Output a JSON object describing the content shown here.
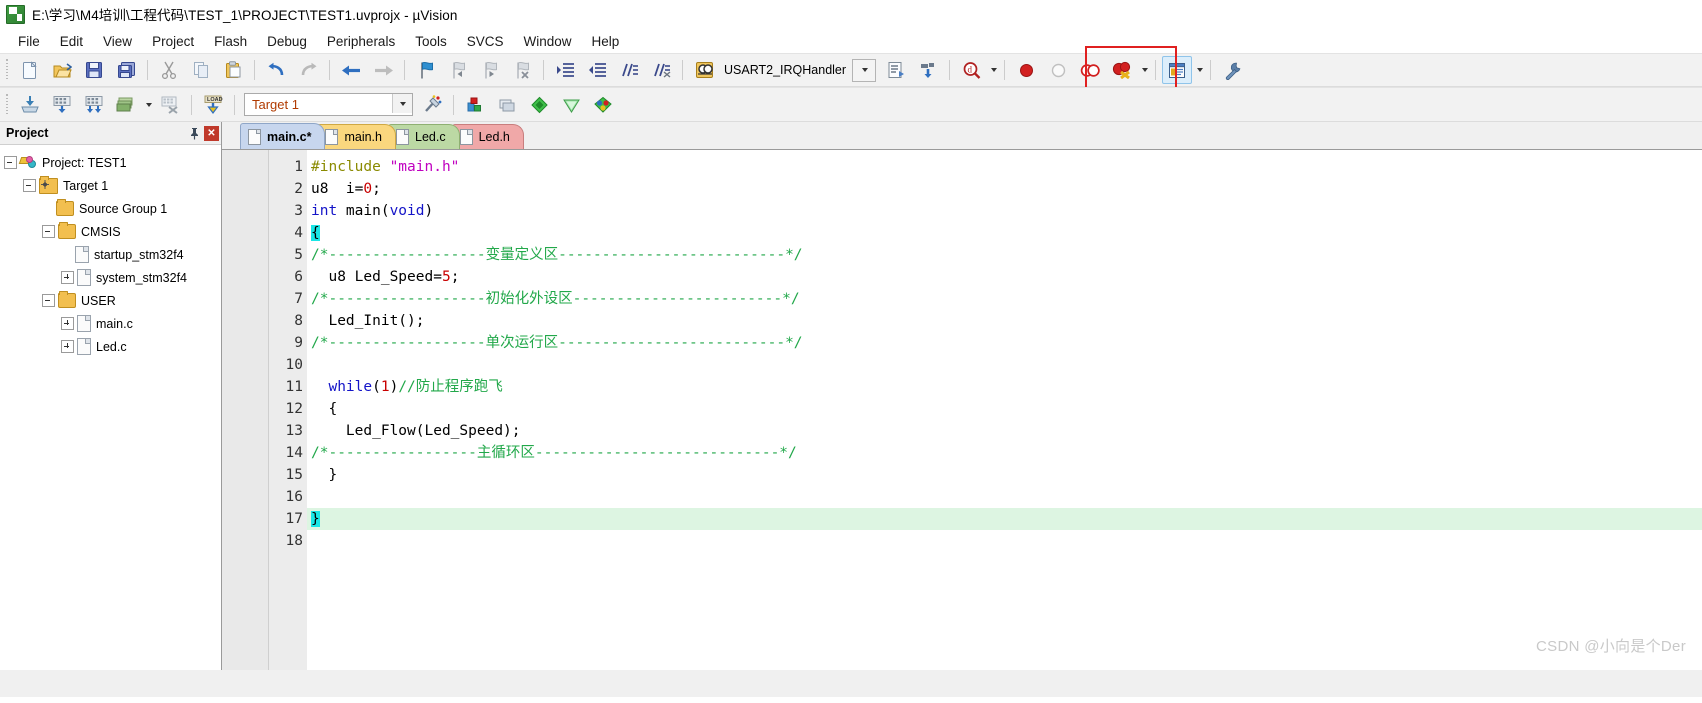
{
  "window": {
    "title": "E:\\学习\\M4培训\\工程代码\\TEST_1\\PROJECT\\TEST1.uvprojx - µVision",
    "app_icon": "uvision-logo-icon"
  },
  "menu": {
    "items": [
      {
        "label": "File"
      },
      {
        "label": "Edit"
      },
      {
        "label": "View"
      },
      {
        "label": "Project"
      },
      {
        "label": "Flash"
      },
      {
        "label": "Debug"
      },
      {
        "label": "Peripherals"
      },
      {
        "label": "Tools"
      },
      {
        "label": "SVCS"
      },
      {
        "label": "Window"
      },
      {
        "label": "Help"
      }
    ]
  },
  "toolbar_main": {
    "buttons": [
      {
        "name": "new-file-icon",
        "title": "New"
      },
      {
        "name": "open-file-icon",
        "title": "Open"
      },
      {
        "name": "save-icon",
        "title": "Save"
      },
      {
        "name": "save-all-icon",
        "title": "Save All"
      },
      {
        "name": "cut-icon",
        "title": "Cut"
      },
      {
        "name": "copy-icon",
        "title": "Copy"
      },
      {
        "name": "paste-icon",
        "title": "Paste"
      },
      {
        "name": "undo-icon",
        "title": "Undo"
      },
      {
        "name": "redo-icon",
        "title": "Redo"
      },
      {
        "name": "navigate-back-icon",
        "title": "Back"
      },
      {
        "name": "navigate-forward-icon",
        "title": "Forward"
      },
      {
        "name": "bookmark-toggle-icon",
        "title": "Insert/Remove Bookmark"
      },
      {
        "name": "bookmark-prev-icon",
        "title": "Previous Bookmark"
      },
      {
        "name": "bookmark-next-icon",
        "title": "Next Bookmark"
      },
      {
        "name": "bookmark-clear-icon",
        "title": "Clear All Bookmarks"
      },
      {
        "name": "indent-icon",
        "title": "Indent"
      },
      {
        "name": "outdent-icon",
        "title": "Outdent"
      },
      {
        "name": "comment-icon",
        "title": "Comment"
      },
      {
        "name": "uncomment-icon",
        "title": "Uncomment"
      },
      {
        "name": "find-in-files-icon",
        "title": "Find in Files"
      }
    ],
    "function_selector": {
      "value": "USART2_IRQHandler",
      "dropdown_icon": "chevron-down-icon"
    },
    "buttons_right": [
      {
        "name": "bookmark-list-icon",
        "title": "Bookmarks"
      },
      {
        "name": "insert-include-icon",
        "title": "Insert Include"
      },
      {
        "name": "find-icon",
        "title": "Find"
      },
      {
        "name": "breakpoint-insert-icon",
        "title": "Insert/Remove Breakpoint"
      },
      {
        "name": "breakpoint-enable-icon",
        "title": "Enable/Disable Breakpoint"
      },
      {
        "name": "breakpoint-disable-all-icon",
        "title": "Disable All Breakpoints"
      },
      {
        "name": "breakpoint-kill-all-icon",
        "title": "Kill All Breakpoints"
      },
      {
        "name": "manage-windows-icon",
        "title": "Manage Windows"
      },
      {
        "name": "configure-target-icon",
        "title": "Configuration Wizard"
      }
    ]
  },
  "toolbar_build": {
    "buttons": [
      {
        "name": "translate-icon",
        "title": "Translate"
      },
      {
        "name": "build-icon",
        "title": "Build"
      },
      {
        "name": "rebuild-icon",
        "title": "Rebuild"
      },
      {
        "name": "batch-build-icon",
        "title": "Batch Build"
      },
      {
        "name": "stop-build-icon",
        "title": "Stop Build"
      },
      {
        "name": "download-icon",
        "title": "Download"
      }
    ],
    "target": {
      "value": "Target 1",
      "dropdown_icon": "chevron-down-icon"
    },
    "buttons_right": [
      {
        "name": "target-options-icon",
        "title": "Options for Target"
      },
      {
        "name": "manage-project-items-icon",
        "title": "Manage Project Items"
      },
      {
        "name": "manage-runtime-env-icon",
        "title": "Manage Run-Time Environment"
      },
      {
        "name": "pack-installer-icon",
        "title": "Pack Installer"
      },
      {
        "name": "select-software-packs-icon",
        "title": "Select Software Packs"
      },
      {
        "name": "multi-project-icon",
        "title": "Multi-Project"
      }
    ]
  },
  "annotation": {
    "highlight_color": "#e02020",
    "target": "configure-target-icon"
  },
  "project_panel": {
    "title": "Project",
    "pin_icon": "pin-icon",
    "close_icon": "close-icon",
    "tree": [
      {
        "label": "Project: TEST1",
        "icon": "project-icon",
        "depth": 0,
        "toggle": "minus"
      },
      {
        "label": "Target 1",
        "icon": "target-folder-icon",
        "depth": 1,
        "toggle": "minus"
      },
      {
        "label": "Source Group 1",
        "icon": "folder-icon",
        "depth": 2,
        "toggle": "none"
      },
      {
        "label": "CMSIS",
        "icon": "folder-icon",
        "depth": 2,
        "toggle": "minus"
      },
      {
        "label": "startup_stm32f4",
        "icon": "file-icon",
        "depth": 3,
        "toggle": "none"
      },
      {
        "label": "system_stm32f4",
        "icon": "file-icon",
        "depth": 3,
        "toggle": "plus"
      },
      {
        "label": "USER",
        "icon": "folder-icon",
        "depth": 2,
        "toggle": "minus"
      },
      {
        "label": "main.c",
        "icon": "file-icon",
        "depth": 3,
        "toggle": "plus"
      },
      {
        "label": "Led.c",
        "icon": "file-icon",
        "depth": 3,
        "toggle": "plus"
      }
    ]
  },
  "editor": {
    "tabs": [
      {
        "label": "main.c*",
        "active": true,
        "bg": "#c7d6ee",
        "border": "#8fa6c8"
      },
      {
        "label": "main.h",
        "active": false,
        "bg": "#fad77e",
        "border": "#cfa843"
      },
      {
        "label": "Led.c",
        "active": false,
        "bg": "#bcd9a4",
        "border": "#8fb072"
      },
      {
        "label": "Led.h",
        "active": false,
        "bg": "#f0a8a8",
        "border": "#c87e7e"
      }
    ],
    "current_line": 17,
    "lines": [
      {
        "n": 1,
        "tokens": [
          {
            "t": "#include ",
            "c": "pp"
          },
          {
            "t": "\"main.h\"",
            "c": "str"
          }
        ]
      },
      {
        "n": 2,
        "tokens": [
          {
            "t": "u8  i=",
            "c": ""
          },
          {
            "t": "0",
            "c": "num"
          },
          {
            "t": ";",
            "c": ""
          }
        ]
      },
      {
        "n": 3,
        "tokens": [
          {
            "t": "int ",
            "c": "k"
          },
          {
            "t": "main(",
            "c": ""
          },
          {
            "t": "void",
            "c": "k"
          },
          {
            "t": ")",
            "c": ""
          }
        ]
      },
      {
        "n": 4,
        "tokens": [
          {
            "t": "{",
            "c": "sel"
          }
        ]
      },
      {
        "n": 5,
        "tokens": [
          {
            "t": "/*------------------变量定义区--------------------------*/",
            "c": "cmt"
          }
        ]
      },
      {
        "n": 6,
        "tokens": [
          {
            "t": "  u8 Led_Speed=",
            "c": ""
          },
          {
            "t": "5",
            "c": "num"
          },
          {
            "t": ";",
            "c": ""
          }
        ]
      },
      {
        "n": 7,
        "tokens": [
          {
            "t": "/*------------------初始化外设区------------------------*/",
            "c": "cmt"
          }
        ]
      },
      {
        "n": 8,
        "tokens": [
          {
            "t": "  Led_Init();",
            "c": ""
          }
        ]
      },
      {
        "n": 9,
        "tokens": [
          {
            "t": "/*------------------单次运行区--------------------------*/",
            "c": "cmt"
          }
        ]
      },
      {
        "n": 10,
        "tokens": []
      },
      {
        "n": 11,
        "tokens": [
          {
            "t": "  while",
            "c": "k"
          },
          {
            "t": "(",
            "c": ""
          },
          {
            "t": "1",
            "c": "num"
          },
          {
            "t": ")",
            "c": ""
          },
          {
            "t": "//防止程序跑飞",
            "c": "cmt"
          }
        ]
      },
      {
        "n": 12,
        "tokens": [
          {
            "t": "  {",
            "c": ""
          }
        ]
      },
      {
        "n": 13,
        "tokens": [
          {
            "t": "    Led_Flow(Led_Speed);",
            "c": ""
          }
        ]
      },
      {
        "n": 14,
        "tokens": [
          {
            "t": "/*-----------------主循环区----------------------------*/",
            "c": "cmt"
          }
        ]
      },
      {
        "n": 15,
        "tokens": [
          {
            "t": "  }",
            "c": ""
          }
        ]
      },
      {
        "n": 16,
        "tokens": []
      },
      {
        "n": 17,
        "tokens": [
          {
            "t": "}",
            "c": "sel"
          }
        ]
      },
      {
        "n": 18,
        "tokens": []
      }
    ]
  },
  "watermark": {
    "text": "CSDN @小向是个Der"
  }
}
